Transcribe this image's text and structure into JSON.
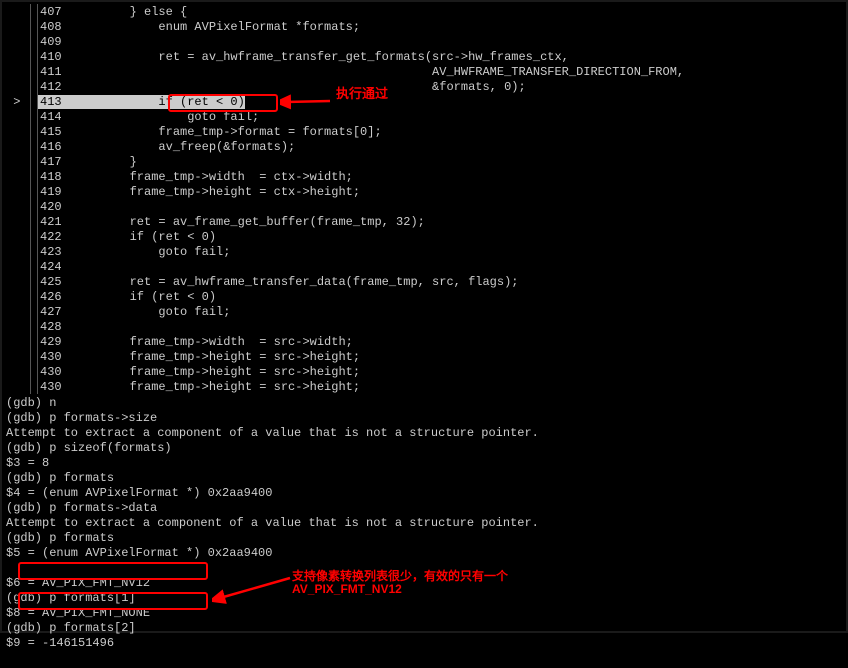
{
  "code": {
    "lines": [
      {
        "n": "407",
        "arrow": "",
        "text": "        } else {"
      },
      {
        "n": "408",
        "arrow": "",
        "text": "            enum AVPixelFormat *formats;"
      },
      {
        "n": "409",
        "arrow": "",
        "text": ""
      },
      {
        "n": "410",
        "arrow": "",
        "text": "            ret = av_hwframe_transfer_get_formats(src->hw_frames_ctx,"
      },
      {
        "n": "411",
        "arrow": "",
        "text": "                                                  AV_HWFRAME_TRANSFER_DIRECTION_FROM,"
      },
      {
        "n": "412",
        "arrow": "",
        "text": "                                                  &formats, 0);"
      },
      {
        "n": "413",
        "arrow": " >",
        "text": "            if (ret < 0)",
        "current": true
      },
      {
        "n": "414",
        "arrow": "",
        "text": "                goto fail;"
      },
      {
        "n": "415",
        "arrow": "",
        "text": "            frame_tmp->format = formats[0];"
      },
      {
        "n": "416",
        "arrow": "",
        "text": "            av_freep(&formats);"
      },
      {
        "n": "417",
        "arrow": "",
        "text": "        }"
      },
      {
        "n": "418",
        "arrow": "",
        "text": "        frame_tmp->width  = ctx->width;"
      },
      {
        "n": "419",
        "arrow": "",
        "text": "        frame_tmp->height = ctx->height;"
      },
      {
        "n": "420",
        "arrow": "",
        "text": ""
      },
      {
        "n": "421",
        "arrow": "",
        "text": "        ret = av_frame_get_buffer(frame_tmp, 32);"
      },
      {
        "n": "422",
        "arrow": "",
        "text": "        if (ret < 0)"
      },
      {
        "n": "423",
        "arrow": "",
        "text": "            goto fail;"
      },
      {
        "n": "424",
        "arrow": "",
        "text": ""
      },
      {
        "n": "425",
        "arrow": "",
        "text": "        ret = av_hwframe_transfer_data(frame_tmp, src, flags);"
      },
      {
        "n": "426",
        "arrow": "",
        "text": "        if (ret < 0)"
      },
      {
        "n": "427",
        "arrow": "",
        "text": "            goto fail;"
      },
      {
        "n": "428",
        "arrow": "",
        "text": ""
      },
      {
        "n": "429",
        "arrow": "",
        "text": "        frame_tmp->width  = src->width;"
      },
      {
        "n": "430",
        "arrow": "",
        "text": "        frame_tmp->height = src->height;"
      },
      {
        "n": "430",
        "arrow": "",
        "text": "        frame_tmp->height = src->height;"
      },
      {
        "n": "430",
        "arrow": "",
        "text": "        frame_tmp->height = src->height;"
      }
    ]
  },
  "gdb": {
    "lines": [
      "(gdb) n",
      "(gdb) p formats->size",
      "Attempt to extract a component of a value that is not a structure pointer.",
      "(gdb) p sizeof(formats)",
      "$3 = 8",
      "(gdb) p formats",
      "$4 = (enum AVPixelFormat *) 0x2aa9400",
      "(gdb) p formats->data",
      "Attempt to extract a component of a value that is not a structure pointer.",
      "(gdb) p formats",
      "$5 = (enum AVPixelFormat *) 0x2aa9400",
      "",
      "$6 = AV_PIX_FMT_NV12",
      "(gdb) p formats[1]",
      "$8 = AV_PIX_FMT_NONE",
      "(gdb) p formats[2]",
      "$9 = -146151496",
      ""
    ]
  },
  "annotations": {
    "top": "执行通过",
    "bottom1": "支持像素转换列表很少，有效的只有一个",
    "bottom2": "AV_PIX_FMT_NV12"
  }
}
